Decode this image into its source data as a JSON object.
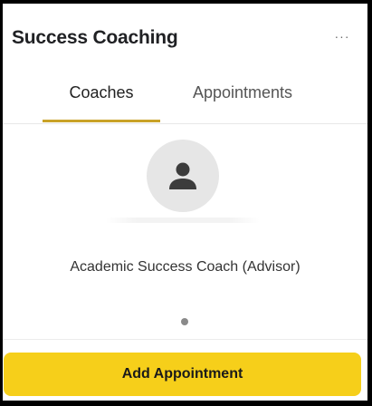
{
  "header": {
    "title": "Success Coaching",
    "more_icon": "more-horizontal-icon",
    "more_label": "···"
  },
  "tabs": [
    {
      "label": "Coaches",
      "selected": true
    },
    {
      "label": "Appointments",
      "selected": false
    }
  ],
  "coach": {
    "avatar_icon": "person-icon",
    "role": "Academic Success Coach (Advisor)"
  },
  "pager": {
    "current_page": 1,
    "total_pages": 1
  },
  "actions": {
    "add_appointment_label": "Add Appointment"
  },
  "colors": {
    "accent": "#c9a227",
    "button": "#f6cf1a"
  }
}
